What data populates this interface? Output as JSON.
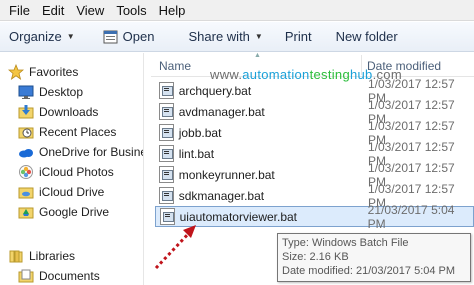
{
  "menu": [
    "File",
    "Edit",
    "View",
    "Tools",
    "Help"
  ],
  "toolbar": {
    "organize": "Organize",
    "open": "Open",
    "share_with": "Share with",
    "print": "Print",
    "new_folder": "New folder"
  },
  "nav": {
    "favorites": "Favorites",
    "items": [
      {
        "label": "Desktop",
        "icon": "desktop-icon"
      },
      {
        "label": "Downloads",
        "icon": "downloads-icon"
      },
      {
        "label": "Recent Places",
        "icon": "recent-places-icon"
      },
      {
        "label": "OneDrive for Busine",
        "icon": "onedrive-icon"
      },
      {
        "label": "iCloud Photos",
        "icon": "icloud-photos-icon"
      },
      {
        "label": "iCloud Drive",
        "icon": "icloud-drive-icon"
      },
      {
        "label": "Google Drive",
        "icon": "google-drive-icon"
      }
    ],
    "libraries": "Libraries",
    "documents": "Documents"
  },
  "columns": {
    "name": "Name",
    "date_modified": "Date modified"
  },
  "watermark": {
    "prefix": "www.",
    "part1": "automation",
    "part2": "testing",
    "part3": "hub",
    "suffix": ".com"
  },
  "files": [
    {
      "name": "archquery.bat",
      "date": "1/03/2017 12:57 PM"
    },
    {
      "name": "avdmanager.bat",
      "date": "1/03/2017 12:57 PM"
    },
    {
      "name": "jobb.bat",
      "date": "1/03/2017 12:57 PM"
    },
    {
      "name": "lint.bat",
      "date": "1/03/2017 12:57 PM"
    },
    {
      "name": "monkeyrunner.bat",
      "date": "1/03/2017 12:57 PM"
    },
    {
      "name": "sdkmanager.bat",
      "date": "1/03/2017 12:57 PM"
    },
    {
      "name": "uiautomatorviewer.bat",
      "date": "21/03/2017 5:04 PM"
    }
  ],
  "tooltip": {
    "type": "Type: Windows Batch File",
    "size": "Size: 2.16 KB",
    "date": "Date modified: 21/03/2017 5:04 PM"
  },
  "colors": {
    "selection": "#dcebfc",
    "arrow": "#c0141b",
    "header_text": "#4c607a"
  }
}
